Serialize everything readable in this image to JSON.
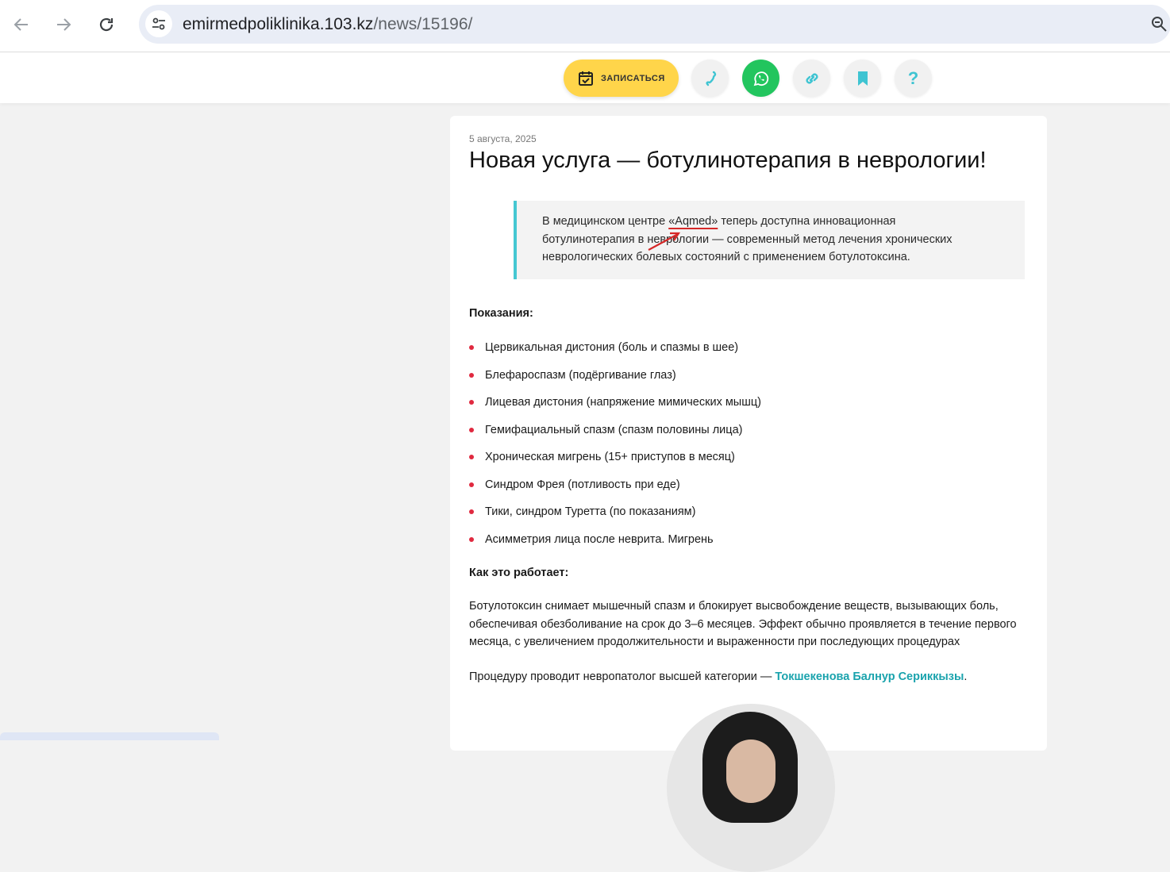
{
  "browser": {
    "url_domain": "emirmedpoliklinika.103.kz",
    "url_path": "/news/15196/"
  },
  "header": {
    "book_label": "ЗАПИСАТЬСЯ",
    "help_label": "?"
  },
  "article": {
    "date": "5 августа, 2025",
    "title": "Новая услуга — ботулинотерапия в неврологии!",
    "quote_before": "В медицинском центре ",
    "quote_brand": "«Aqmed»",
    "quote_after": " теперь доступна инновационная ботулинотерапия в неврологии — современный метод лечения хронических неврологических болевых состояний с применением ботулотоксина.",
    "indications_heading": "Показания:",
    "indications": [
      "Цервикальная дистония (боль и спазмы в шее)",
      "Блефароспазм (подёргивание глаз)",
      "Лицевая дистония (напряжение мимических мышц)",
      "Гемифациальный спазм (спазм половины лица)",
      "Хроническая мигрень (15+ приступов в месяц)",
      "Синдром Фрея (потливость при еде)",
      "Тики, синдром Туретта (по показаниям)",
      "Асимметрия лица после неврита. Мигрень"
    ],
    "how_heading": "Как это работает:",
    "how_text": "Ботулотоксин снимает мышечный спазм и блокирует высвобождение веществ, вызывающих боль, обеспечивая обезболивание на срок до 3–6 месяцев. Эффект обычно проявляется в течение первого месяца, с увеличением продолжительности и выраженности при последующих процедурах",
    "doctor_intro": "Процедуру проводит невропатолог высшей категории — ",
    "doctor_name": "Токшекенова Балнур Сериккызы",
    "doctor_end": "."
  },
  "colors": {
    "accent_teal": "#1aa3ad",
    "book_yellow": "#ffd54a",
    "whatsapp_green": "#22c55e",
    "bullet_red": "#e0293f"
  },
  "icons": [
    "back-arrow-icon",
    "forward-arrow-icon",
    "reload-icon",
    "site-settings-icon",
    "zoom-icon",
    "calendar-icon",
    "phone-icon",
    "whatsapp-icon",
    "link-icon",
    "bookmark-icon",
    "help-icon"
  ]
}
